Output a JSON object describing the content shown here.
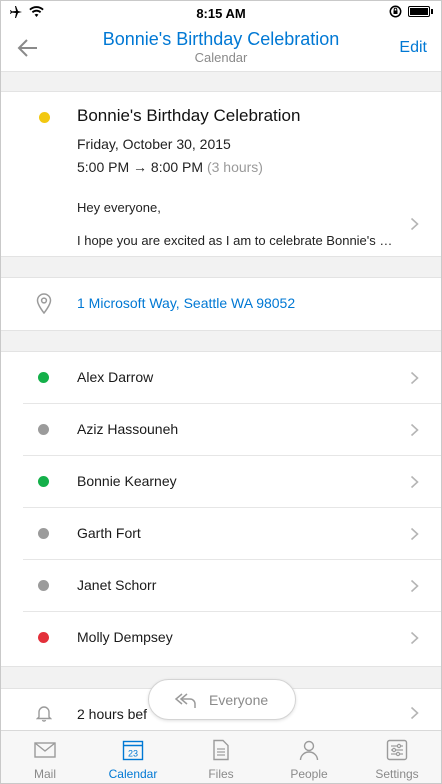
{
  "status_bar": {
    "time": "8:15 AM"
  },
  "nav": {
    "title": "Bonnie's Birthday Celebration",
    "subtitle": "Calendar",
    "edit_label": "Edit"
  },
  "event": {
    "title": "Bonnie's Birthday Celebration",
    "date": "Friday, October 30, 2015",
    "time_range": "5:00 PM → 8:00 PM",
    "duration": "(3 hours)",
    "body_line1": "Hey everyone,",
    "body_line2": "I hope you are excited as I am to celebrate Bonnie's birthday",
    "color": "#f2c811"
  },
  "location": {
    "text": "1 Microsoft Way, Seattle WA 98052"
  },
  "attendees": [
    {
      "name": "Alex Darrow",
      "status_color": "#14b04a"
    },
    {
      "name": "Aziz Hassouneh",
      "status_color": "#9b9b9b"
    },
    {
      "name": "Bonnie Kearney",
      "status_color": "#14b04a"
    },
    {
      "name": "Garth Fort",
      "status_color": "#9b9b9b"
    },
    {
      "name": "Janet Schorr",
      "status_color": "#9b9b9b"
    },
    {
      "name": "Molly Dempsey",
      "status_color": "#e3303a"
    }
  ],
  "reminder": {
    "text": "2 hours bef"
  },
  "reply_button": {
    "label": "Everyone"
  },
  "tabs": [
    {
      "label": "Mail",
      "icon": "mail-icon"
    },
    {
      "label": "Calendar",
      "icon": "calendar-icon",
      "day": "23"
    },
    {
      "label": "Files",
      "icon": "files-icon"
    },
    {
      "label": "People",
      "icon": "people-icon"
    },
    {
      "label": "Settings",
      "icon": "settings-icon"
    }
  ],
  "colors": {
    "accent": "#0078d4",
    "inactive": "#8a8a8a"
  }
}
